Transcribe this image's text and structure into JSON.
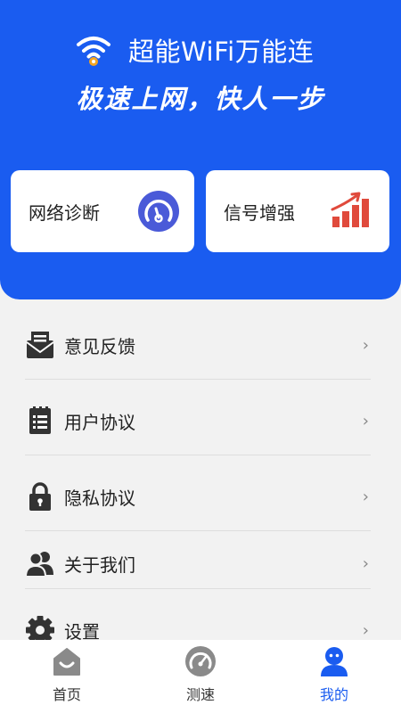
{
  "header": {
    "brand_name": "超能WiFi万能连",
    "slogan": "极速上网，快人一步",
    "bg_color": "#1a5cf0",
    "logo_icon": "wifi-logo-icon"
  },
  "cards": [
    {
      "label": "网络诊断",
      "icon": "gauge-icon",
      "icon_color": "#4a5ad8"
    },
    {
      "label": "信号增强",
      "icon": "signal-bars-icon",
      "icon_color": "#e04a3c"
    }
  ],
  "menu": {
    "items": [
      {
        "label": "意见反馈",
        "icon": "feedback-icon"
      },
      {
        "label": "用户协议",
        "icon": "document-icon"
      },
      {
        "label": "隐私协议",
        "icon": "lock-icon"
      },
      {
        "label": "关于我们",
        "icon": "users-icon"
      },
      {
        "label": "设置",
        "icon": "gear-icon"
      }
    ],
    "chevron": "›"
  },
  "tabbar": {
    "tabs": [
      {
        "label": "首页",
        "icon": "home-icon",
        "active": false
      },
      {
        "label": "测速",
        "icon": "speedometer-icon",
        "active": false
      },
      {
        "label": "我的",
        "icon": "profile-icon",
        "active": true
      }
    ],
    "active_color": "#1a5cf0"
  }
}
